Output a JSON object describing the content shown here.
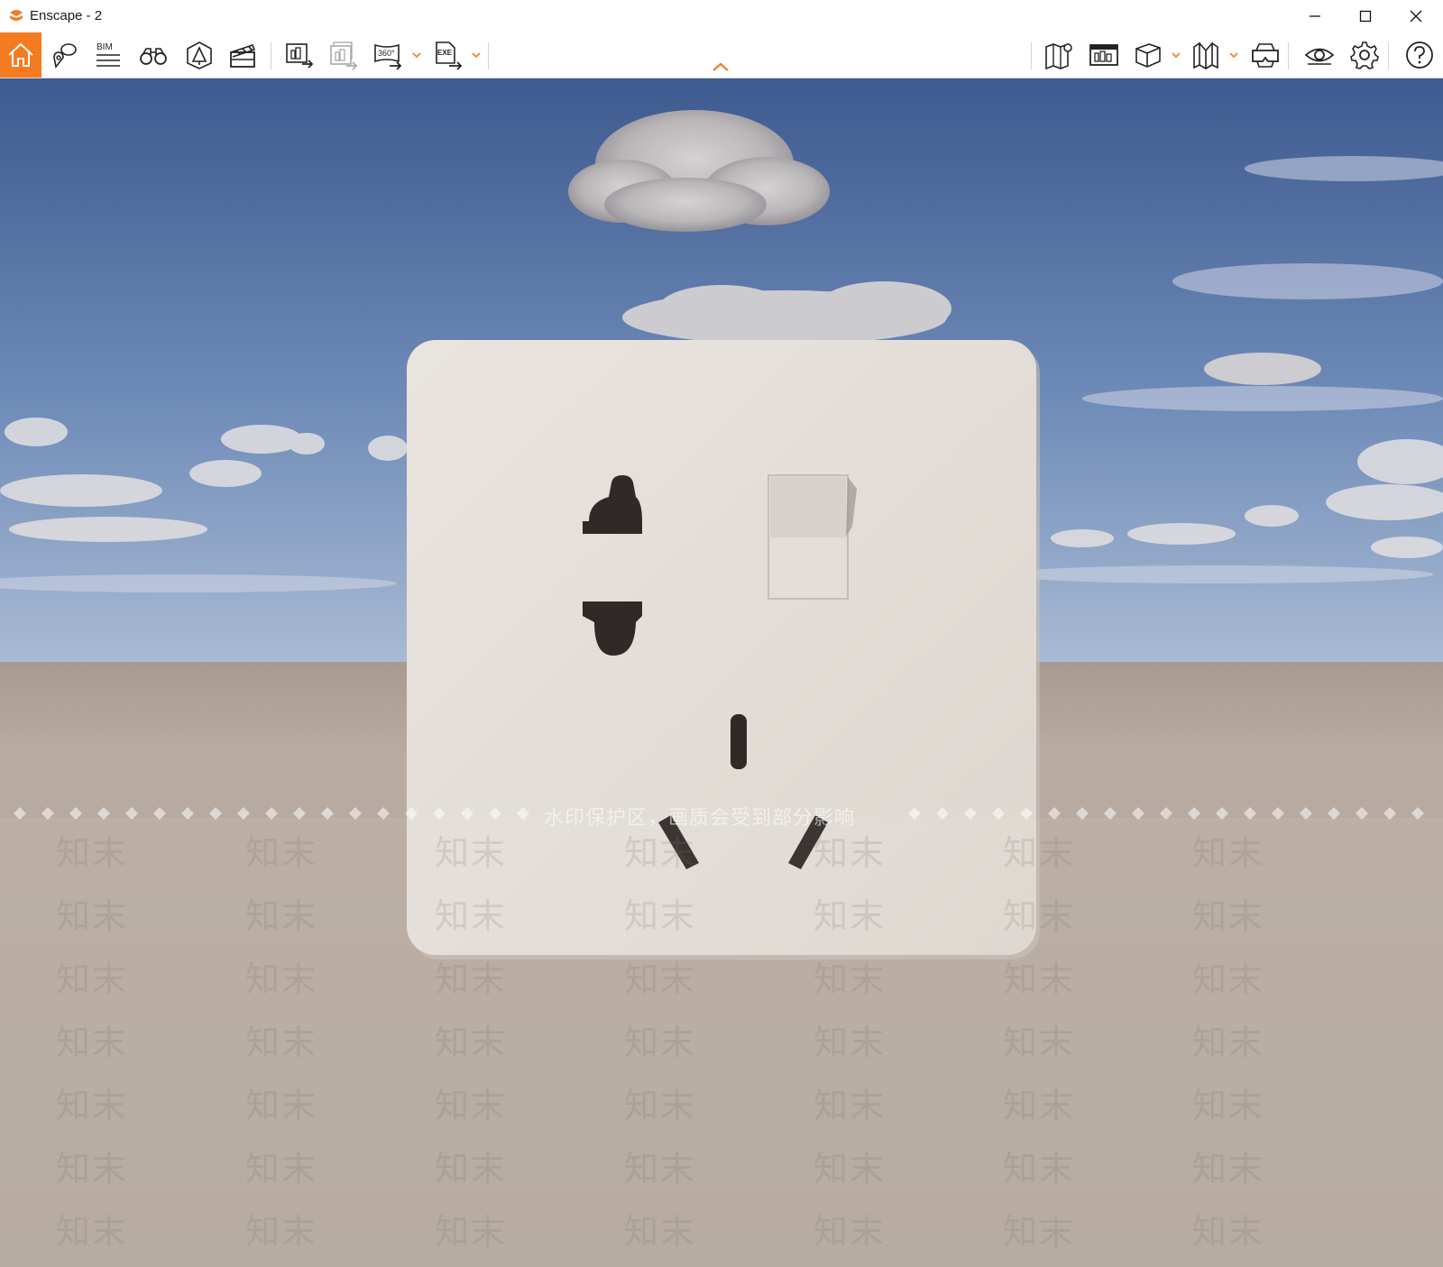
{
  "window": {
    "title": "Enscape - 2",
    "brand_color": "#f47b20"
  },
  "toolbar": {
    "left_tools": [
      {
        "name": "home-icon",
        "active": true
      },
      {
        "name": "location-pin-icon"
      },
      {
        "name": "bim-icon",
        "label": "BIM"
      },
      {
        "name": "binoculars-icon"
      },
      {
        "name": "asset-library-icon"
      },
      {
        "name": "clapperboard-icon"
      },
      {
        "name": "render-image-icon"
      },
      {
        "name": "batch-render-icon"
      },
      {
        "name": "render-360-icon",
        "label": "360°"
      },
      {
        "name": "export-exe-icon",
        "label": "EXE"
      }
    ],
    "right_tools": [
      {
        "name": "map-icon"
      },
      {
        "name": "visual-settings-icon"
      },
      {
        "name": "cube-view-icon"
      },
      {
        "name": "book-icon"
      },
      {
        "name": "vr-headset-icon"
      },
      {
        "name": "eye-icon"
      },
      {
        "name": "gear-icon"
      },
      {
        "name": "help-icon"
      }
    ]
  },
  "viewport": {
    "watermark_caption": "水印保护区，画质会受到部分影响",
    "watermark_logo": "知末"
  },
  "colors": {
    "sky_top": "#3e5a8f",
    "sky_bottom": "#9bb2cf",
    "ground": "#b7aaa0",
    "socket_panel": "#e6e0da",
    "socket_hole": "#2f2a28"
  }
}
